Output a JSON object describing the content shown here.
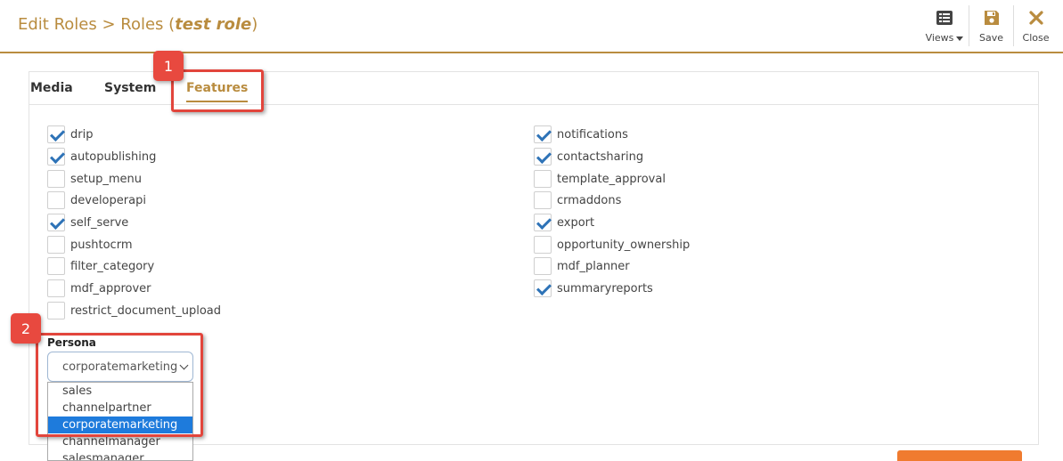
{
  "header": {
    "title_prefix": "Edit Roles > Roles (",
    "role_name": "test role",
    "title_suffix": ")",
    "views_label": "Views",
    "save_label": "Save",
    "close_label": "Close"
  },
  "tabs": [
    "Media",
    "System",
    "Features"
  ],
  "features": {
    "left": [
      {
        "label": "drip",
        "checked": true
      },
      {
        "label": "autopublishing",
        "checked": true
      },
      {
        "label": "setup_menu",
        "checked": false
      },
      {
        "label": "developerapi",
        "checked": false
      },
      {
        "label": "self_serve",
        "checked": true
      },
      {
        "label": "pushtocrm",
        "checked": false
      },
      {
        "label": "filter_category",
        "checked": false
      },
      {
        "label": "mdf_approver",
        "checked": false
      },
      {
        "label": "restrict_document_upload",
        "checked": false
      }
    ],
    "right": [
      {
        "label": "notifications",
        "checked": true
      },
      {
        "label": "contactsharing",
        "checked": true
      },
      {
        "label": "template_approval",
        "checked": false
      },
      {
        "label": "crmaddons",
        "checked": false
      },
      {
        "label": "export",
        "checked": true
      },
      {
        "label": "opportunity_ownership",
        "checked": false
      },
      {
        "label": "mdf_planner",
        "checked": false
      },
      {
        "label": "summaryreports",
        "checked": true
      }
    ]
  },
  "persona": {
    "label": "Persona",
    "selected": "corporatemarketing",
    "options": [
      "sales",
      "channelpartner",
      "corporatemarketing",
      "channelmanager",
      "salesmanager"
    ]
  },
  "annotations": {
    "badge1": "1",
    "badge2": "2"
  },
  "colors": {
    "accent": "#b98c3f",
    "check": "#2e73b7",
    "highlight": "#e2453c",
    "selected_option": "#1e7bdc"
  }
}
